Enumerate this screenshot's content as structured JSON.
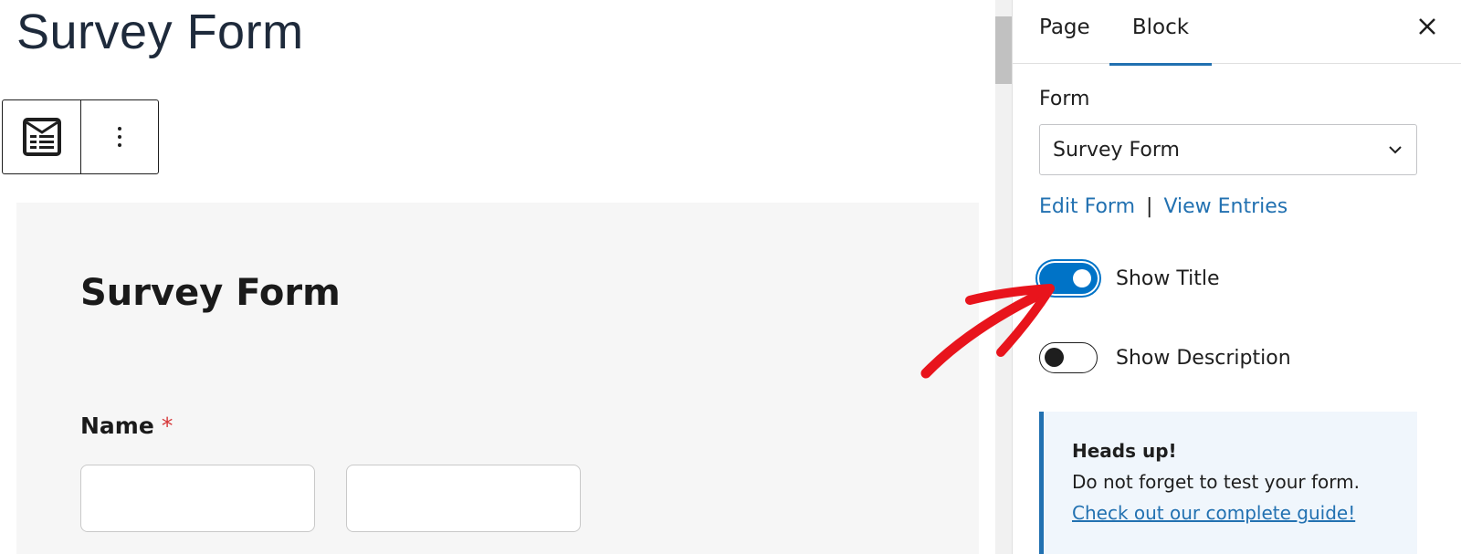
{
  "editor": {
    "page_title": "Survey Form",
    "block_toolbar": {
      "block_icon": "form-block-icon",
      "options_icon": "kebab-menu-icon"
    },
    "form_preview": {
      "title": "Survey Form",
      "fields": [
        {
          "label": "Name",
          "required_marker": "*"
        }
      ]
    }
  },
  "sidebar": {
    "tabs": [
      {
        "label": "Page",
        "active": false
      },
      {
        "label": "Block",
        "active": true
      }
    ],
    "close_icon": "close-icon",
    "form_label": "Form",
    "form_select_value": "Survey Form",
    "links": {
      "edit": "Edit Form",
      "separator": "|",
      "view": "View Entries"
    },
    "toggles": [
      {
        "label": "Show Title",
        "checked": true
      },
      {
        "label": "Show Description",
        "checked": false
      }
    ],
    "notice": {
      "title": "Heads up!",
      "text": "Do not forget to test your form.",
      "link": "Check out our complete guide!"
    }
  },
  "colors": {
    "accent": "#2271b1",
    "toggle_on": "#0073c7",
    "required": "#d63638",
    "annotation_arrow": "#e8141c",
    "preview_bg": "#f6f6f6",
    "notice_bg": "#f0f6fc"
  }
}
